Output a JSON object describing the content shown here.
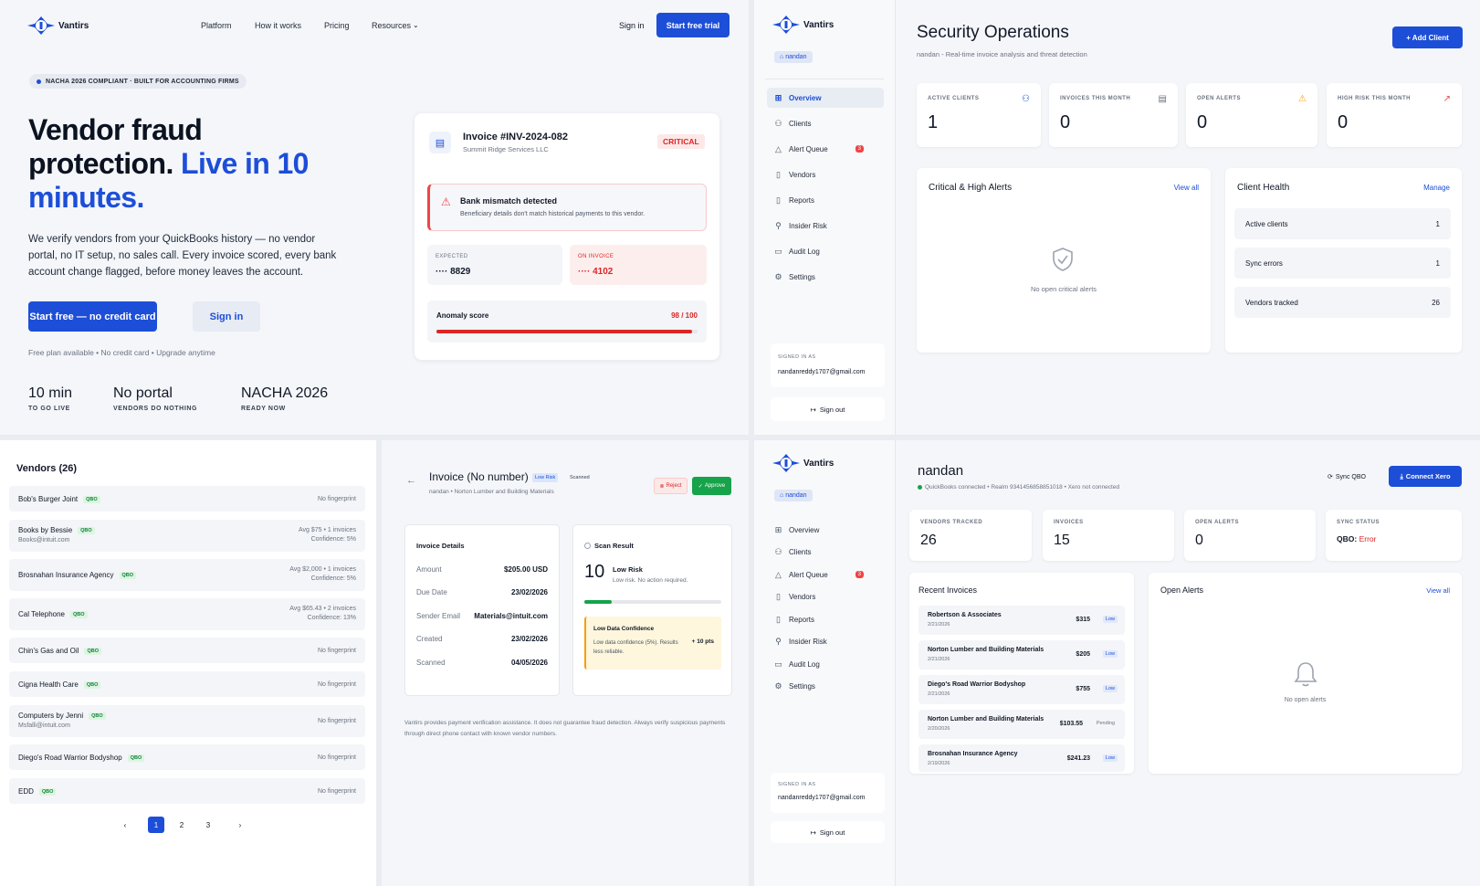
{
  "landing": {
    "brand": "Vantirs",
    "nav": [
      "Platform",
      "How it works",
      "Pricing",
      "Resources"
    ],
    "sign_in": "Sign in",
    "start_trial": "Start free trial",
    "badge": "NACHA 2026 COMPLIANT · BUILT FOR ACCOUNTING FIRMS",
    "title_a": "Vendor fraud",
    "title_b": "protection. ",
    "title_c": "Live in 10",
    "title_d": "minutes.",
    "subtitle": "We verify vendors from your QuickBooks history — no vendor portal, no IT setup, no sales call. Every invoice scored, every bank account change flagged, before money leaves the account.",
    "cta_primary": "Start free — no credit card",
    "cta_secondary": "Sign in",
    "fine_print": "Free plan available • No credit card • Upgrade anytime",
    "stats": [
      {
        "value": "10 min",
        "label": "TO GO LIVE"
      },
      {
        "value": "No portal",
        "label": "VENDORS DO NOTHING"
      },
      {
        "value": "NACHA 2026",
        "label": "READY NOW"
      }
    ],
    "invoice_card": {
      "title": "Invoice #INV-2024-082",
      "vendor": "Summit Ridge Services LLC",
      "severity": "CRITICAL",
      "alert_title": "Bank mismatch detected",
      "alert_text": "Beneficiary details don't match historical payments to this vendor.",
      "expected_label": "EXPECTED",
      "expected_value": "···· 8829",
      "on_invoice_label": "ON INVOICE",
      "on_invoice_value": "···· 4102",
      "anomaly_label": "Anomaly score",
      "anomaly_value": "98 / 100",
      "anomaly_fraction": 0.98
    }
  },
  "dashboard": {
    "brand": "Vantirs",
    "workspace": "nandan",
    "sidebar": [
      {
        "label": "Overview",
        "icon": "grid-icon"
      },
      {
        "label": "Clients",
        "icon": "users-icon"
      },
      {
        "label": "Alert Queue",
        "icon": "alert-icon",
        "count": "3"
      },
      {
        "label": "Vendors",
        "icon": "document-icon"
      },
      {
        "label": "Reports",
        "icon": "document-icon"
      },
      {
        "label": "Insider Risk",
        "icon": "user-plus-icon"
      },
      {
        "label": "Audit Log",
        "icon": "clipboard-icon"
      },
      {
        "label": "Settings",
        "icon": "gear-icon"
      }
    ],
    "signed_in_label": "SIGNED IN AS",
    "email": "nandanreddy1707@gmail.com",
    "sign_out": "Sign out",
    "title": "Security Operations",
    "subtitle": "nandan - Real-time invoice analysis and threat detection",
    "add_client": "+ Add Client",
    "kpis": [
      {
        "label": "ACTIVE CLIENTS",
        "value": "1"
      },
      {
        "label": "INVOICES THIS MONTH",
        "value": "0"
      },
      {
        "label": "OPEN ALERTS",
        "value": "0"
      },
      {
        "label": "HIGH RISK THIS MONTH",
        "value": "0"
      }
    ],
    "critical_title": "Critical & High Alerts",
    "view_all": "View all",
    "empty_alerts": "No open critical alerts",
    "health_title": "Client Health",
    "manage": "Manage",
    "health": [
      {
        "label": "Active clients",
        "value": "1"
      },
      {
        "label": "Sync errors",
        "value": "1"
      },
      {
        "label": "Vendors tracked",
        "value": "26"
      }
    ]
  },
  "vendors": {
    "title": "Vendors (26)",
    "qbo": "QBO",
    "items": [
      {
        "name": "Bob's Burger Joint",
        "email": "",
        "meta1": "No fingerprint",
        "meta2": ""
      },
      {
        "name": "Books by Bessie",
        "email": "Books@intuit.com",
        "meta1": "Avg $75 • 1 invoices",
        "meta2": "Confidence: 5%"
      },
      {
        "name": "Brosnahan Insurance Agency",
        "email": "",
        "meta1": "Avg $2,000 • 1 invoices",
        "meta2": "Confidence: 5%"
      },
      {
        "name": "Cal Telephone",
        "email": "",
        "meta1": "Avg $65.43 • 2 invoices",
        "meta2": "Confidence: 13%"
      },
      {
        "name": "Chin's Gas and Oil",
        "email": "",
        "meta1": "No fingerprint",
        "meta2": ""
      },
      {
        "name": "Cigna Health Care",
        "email": "",
        "meta1": "No fingerprint",
        "meta2": ""
      },
      {
        "name": "Computers by Jenni",
        "email": "Msfalli@intuit.com",
        "meta1": "No fingerprint",
        "meta2": ""
      },
      {
        "name": "Diego's Road Warrior Bodyshop",
        "email": "",
        "meta1": "No fingerprint",
        "meta2": ""
      },
      {
        "name": "EDD",
        "email": "",
        "meta1": "No fingerprint",
        "meta2": ""
      }
    ],
    "pages": [
      "1",
      "2",
      "3"
    ],
    "prev": "‹",
    "next": "›"
  },
  "invoice": {
    "title": "Invoice (No number)",
    "risk_tag": "Low Risk",
    "scanned_tag": "Scanned",
    "vendor_line": "nandan • Norton Lumber and Building Materials",
    "reject": "Reject",
    "approve": "Approve",
    "details_title": "Invoice Details",
    "details": [
      {
        "label": "Amount",
        "value": "$205.00 USD"
      },
      {
        "label": "Due Date",
        "value": "23/02/2026"
      },
      {
        "label": "Sender Email",
        "value": "Materials@intuit.com"
      },
      {
        "label": "Created",
        "value": "23/02/2026"
      },
      {
        "label": "Scanned",
        "value": "04/05/2026"
      }
    ],
    "scan_title": "Scan Result",
    "score": "10",
    "risk_label": "Low Risk",
    "risk_note": "Low risk. No action required.",
    "score_fraction": 0.2,
    "conf_title": "Low Data Confidence",
    "conf_text": "Low data confidence (5%). Results less reliable.",
    "conf_pts": "+ 10 pts",
    "disclaimer": "Vantirs provides payment verification assistance. It does not guarantee fraud detection. Always verify suspicious payments through direct phone contact with known vendor numbers."
  },
  "client": {
    "brand": "Vantirs",
    "workspace": "nandan",
    "sidebar": [
      "Overview",
      "Clients",
      "Alert Queue",
      "Vendors",
      "Reports",
      "Insider Risk",
      "Audit Log",
      "Settings"
    ],
    "alert_count": "3",
    "signed_in_label": "SIGNED IN AS",
    "email": "nandanreddy1707@gmail.com",
    "sign_out": "Sign out",
    "title": "nandan",
    "status": "QuickBooks connected • Realm 9341456858851018 • Xero not connected",
    "sync_qbo": "Sync QBO",
    "connect_xero": "Connect Xero",
    "kpis": [
      {
        "label": "VENDORS TRACKED",
        "value": "26"
      },
      {
        "label": "INVOICES",
        "value": "15"
      },
      {
        "label": "OPEN ALERTS",
        "value": "0"
      },
      {
        "label": "SYNC STATUS",
        "value": "QBO: ",
        "value2": "Error"
      }
    ],
    "recent_title": "Recent Invoices",
    "invoices": [
      {
        "name": "Robertson & Associates",
        "date": "2/21/2026",
        "amount": "$315",
        "status": "Low"
      },
      {
        "name": "Norton Lumber and Building Materials",
        "date": "2/21/2026",
        "amount": "$205",
        "status": "Low"
      },
      {
        "name": "Diego's Road Warrior Bodyshop",
        "date": "2/21/2026",
        "amount": "$755",
        "status": "Low"
      },
      {
        "name": "Norton Lumber and Building Materials",
        "date": "2/20/2026",
        "amount": "$103.55",
        "status": "Pending"
      },
      {
        "name": "Brosnahan Insurance Agency",
        "date": "2/19/2026",
        "amount": "$241.23",
        "status": "Low"
      }
    ],
    "open_alerts_title": "Open Alerts",
    "view_all": "View all",
    "empty_alerts": "No open alerts"
  },
  "colors": {
    "brand": "#1d4ed8",
    "critical": "#dc2626",
    "success": "#16a34a",
    "warning": "#f59e0b"
  }
}
